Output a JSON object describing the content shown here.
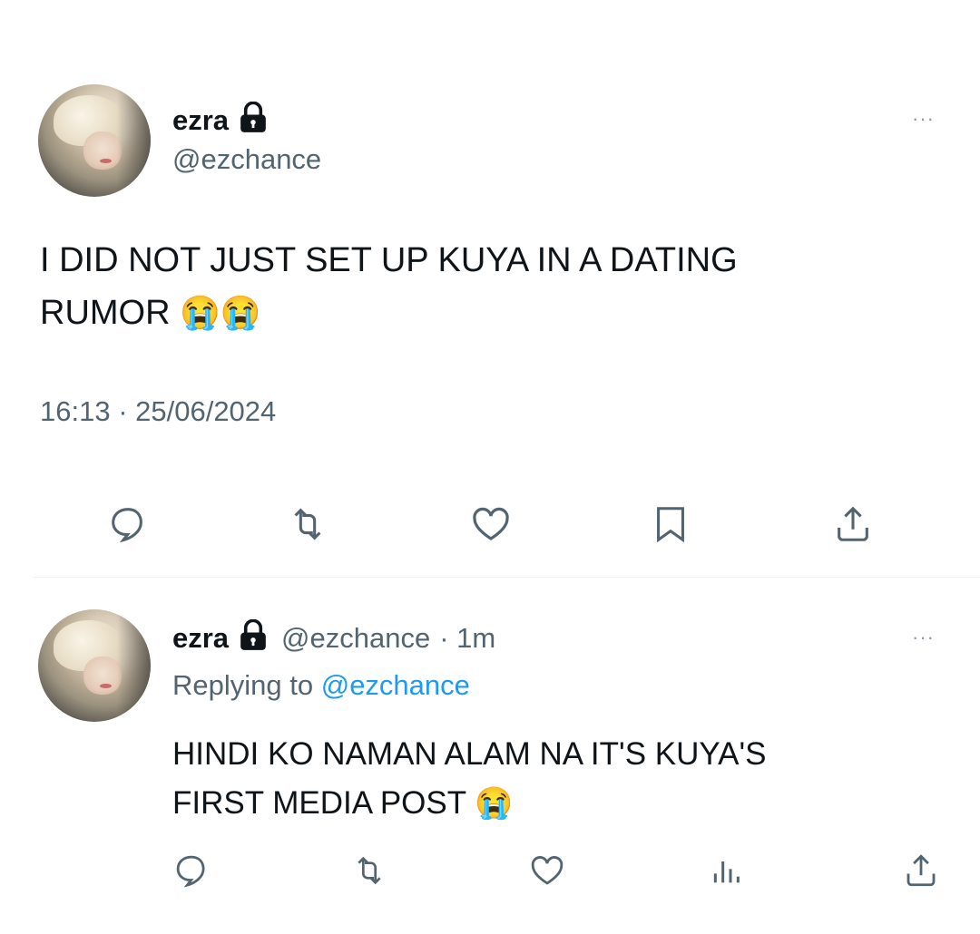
{
  "tweet": {
    "display_name": "ezra",
    "handle": "@ezchance",
    "text_line1": "I DID NOT JUST SET UP KUYA IN A DATING",
    "text_line2": "RUMOR",
    "emojis": "😭😭",
    "timestamp": "16:13 · 25/06/2024",
    "more": "···",
    "actions": [
      "reply-icon",
      "retweet-icon",
      "like-icon",
      "bookmark-icon",
      "share-icon"
    ]
  },
  "reply": {
    "display_name": "ezra",
    "handle": "@ezchance",
    "dot_time": "· 1m",
    "replying_to_label": "Replying to",
    "replying_to_handle": "@ezchance",
    "text_line1": "HINDI KO NAMAN ALAM NA IT'S KUYA'S",
    "text_line2": "FIRST MEDIA POST",
    "emoji": "😭",
    "more": "···",
    "actions": [
      "reply-icon",
      "retweet-icon",
      "like-icon",
      "views-icon",
      "share-icon"
    ]
  },
  "colors": {
    "text": "#0f1419",
    "secondary": "#536471",
    "link": "#1d9bf0"
  }
}
